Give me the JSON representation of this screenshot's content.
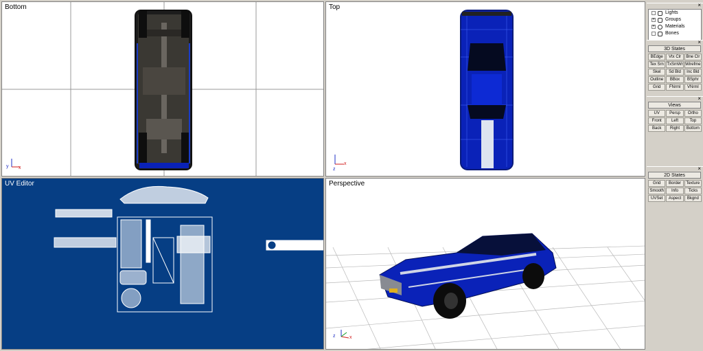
{
  "viewports": {
    "bottom": {
      "label": "Bottom"
    },
    "top": {
      "label": "Top"
    },
    "uv": {
      "label": "UV Editor"
    },
    "perspective": {
      "label": "Perspective"
    }
  },
  "axes": {
    "x": "x",
    "y": "y",
    "z": "z"
  },
  "tree": {
    "items": [
      {
        "label": "Lights",
        "expander": "",
        "icon": "light-icon"
      },
      {
        "label": "Groups",
        "expander": "+",
        "icon": "group-icon"
      },
      {
        "label": "Materials",
        "expander": "+",
        "icon": "material-icon"
      },
      {
        "label": "Bones",
        "expander": "",
        "icon": "bone-icon"
      }
    ]
  },
  "states3d": {
    "header": "3D States",
    "buttons": [
      "BEdge",
      "Vtx Clr",
      "Bne Clr",
      "Tex Srn",
      "TxSmWr",
      "Wirefme",
      "Skel",
      "Sd Bld",
      "Inc Bld",
      "Outline",
      "BBox",
      "BSphr",
      "Grid",
      "FNrml",
      "VNrml"
    ]
  },
  "views": {
    "header": "Views",
    "buttons": [
      "UV",
      "Persp",
      "Ortho",
      "Front",
      "Left",
      "Top",
      "Back",
      "Right",
      "Bottom"
    ]
  },
  "states2d": {
    "header": "2D States",
    "buttons": [
      "Grid",
      "Border",
      "Texture",
      "Smooth",
      "Info",
      "Ticks",
      "UVSet",
      "Aspect",
      "Bkgnd"
    ]
  },
  "panel_close_glyph": "×",
  "colors": {
    "car_body": "#0a22b8",
    "uv_background": "#063e84",
    "panel_bg": "#d4d0c8"
  }
}
